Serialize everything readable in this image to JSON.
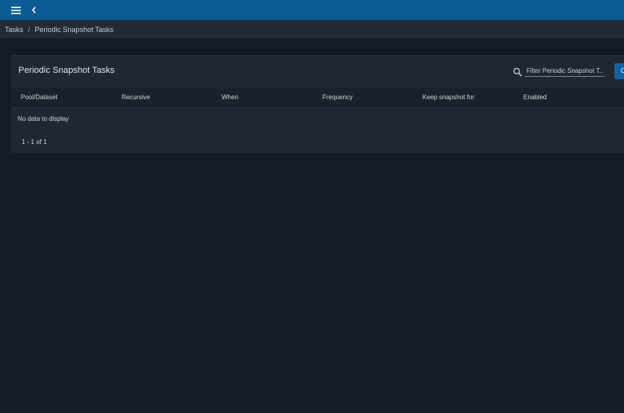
{
  "topbar": {
    "menu_icon": "menu-icon",
    "back_icon": "chevron-left-icon",
    "color": "#0a5a94"
  },
  "breadcrumb": {
    "items": [
      "Tasks",
      "Periodic Snapshot Tasks"
    ],
    "separator": "/"
  },
  "card": {
    "title": "Periodic Snapshot Tasks",
    "search": {
      "icon": "search-icon",
      "placeholder": "Filter Periodic Snapshot T..."
    },
    "columns_button_label": "C",
    "columns": [
      "Pool/Dataset",
      "Recursive",
      "When",
      "Frequency",
      "Keep snapshot for",
      "Enabled"
    ],
    "empty_message": "No data to display",
    "pager": "1 - 1 of 1"
  }
}
